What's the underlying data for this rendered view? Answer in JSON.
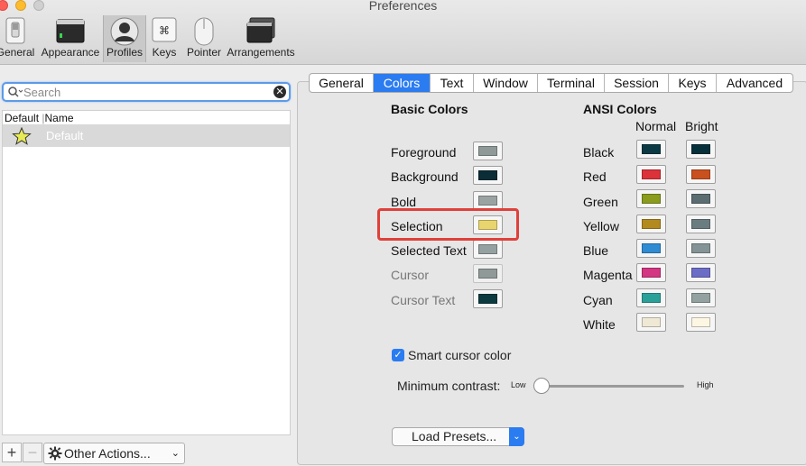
{
  "window": {
    "title": "Preferences"
  },
  "toolbar": {
    "items": [
      {
        "label": "General"
      },
      {
        "label": "Appearance"
      },
      {
        "label": "Profiles"
      },
      {
        "label": "Keys"
      },
      {
        "label": "Pointer"
      },
      {
        "label": "Arrangements"
      }
    ],
    "selected": "Profiles"
  },
  "search": {
    "placeholder": "Search",
    "value": ""
  },
  "profiles_list": {
    "header_default": "Default",
    "header_name": "Name",
    "rows": [
      {
        "name": "Default"
      }
    ]
  },
  "bottom": {
    "add": "+",
    "remove": "−",
    "actions_label": "Other Actions..."
  },
  "tabs": {
    "items": [
      {
        "label": "General"
      },
      {
        "label": "Colors"
      },
      {
        "label": "Text"
      },
      {
        "label": "Window"
      },
      {
        "label": "Terminal"
      },
      {
        "label": "Session"
      },
      {
        "label": "Keys"
      },
      {
        "label": "Advanced"
      }
    ],
    "active": "Colors"
  },
  "basic_colors": {
    "title": "Basic Colors",
    "items": [
      {
        "label": "Foreground",
        "color": "#8f9a98"
      },
      {
        "label": "Background",
        "color": "#0b2d36"
      },
      {
        "label": "Bold",
        "color": "#9aa2a2"
      },
      {
        "label": "Selection",
        "color": "#e8d56e"
      },
      {
        "label": "Selected Text",
        "color": "#95a0a0"
      },
      {
        "label": "Cursor",
        "color": "#8f9a98"
      },
      {
        "label": "Cursor Text",
        "color": "#0b3a40"
      }
    ]
  },
  "ansi_colors": {
    "title": "ANSI Colors",
    "normal_label": "Normal",
    "bright_label": "Bright",
    "items": [
      {
        "label": "Black",
        "normal": "#0b3a44",
        "bright": "#06303a"
      },
      {
        "label": "Red",
        "normal": "#dc3239",
        "bright": "#c9501f"
      },
      {
        "label": "Green",
        "normal": "#8a9b1e",
        "bright": "#5b6d70"
      },
      {
        "label": "Yellow",
        "normal": "#b38a1e",
        "bright": "#6b7d80"
      },
      {
        "label": "Blue",
        "normal": "#2f8bd2",
        "bright": "#849395"
      },
      {
        "label": "Magenta",
        "normal": "#d33682",
        "bright": "#6c6ec6"
      },
      {
        "label": "Cyan",
        "normal": "#2aa198",
        "bright": "#93a1a1"
      },
      {
        "label": "White",
        "normal": "#eee8d5",
        "bright": "#fdf6e3"
      }
    ]
  },
  "options": {
    "smart_cursor_label": "Smart cursor color",
    "smart_cursor_checked": true,
    "min_contrast_label": "Minimum contrast:",
    "low_label": "Low",
    "high_label": "High",
    "min_contrast_value": 0
  },
  "presets": {
    "label": "Load Presets..."
  },
  "colors": {
    "accent": "#2b7cf0",
    "highlight": "#e0403a"
  }
}
